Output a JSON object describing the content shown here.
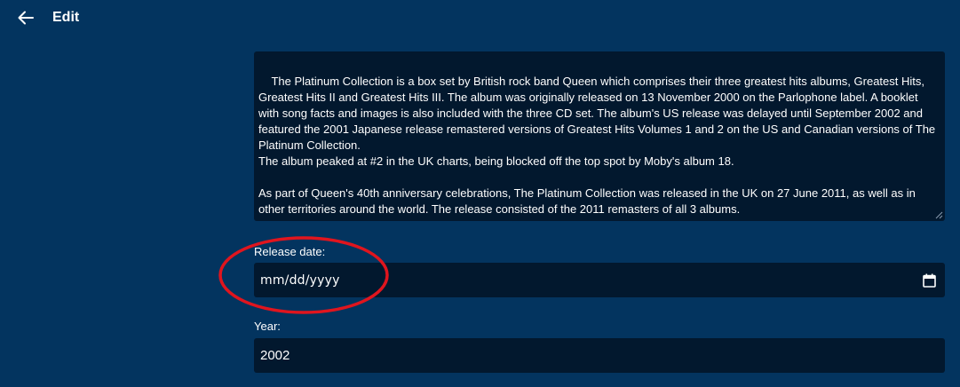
{
  "header": {
    "title": "Edit",
    "back_icon": "arrow-left-icon"
  },
  "description": {
    "value": "The Platinum Collection is a box set by British rock band Queen which comprises their three greatest hits albums, Greatest Hits, Greatest Hits II and Greatest Hits III. The album was originally released on 13 November 2000 on the Parlophone label. A booklet with song facts and images is also included with the three CD set. The album's US release was delayed until September 2002 and featured the 2001 Japanese release remastered versions of Greatest Hits Volumes 1 and 2 on the US and Canadian versions of The Platinum Collection.\nThe album peaked at #2 in the UK charts, being blocked off the top spot by Moby's album 18.\n\nAs part of Queen's 40th anniversary celebrations, The Platinum Collection was released in the UK on 27 June 2011, as well as in other territories around the world. The release consisted of the 2011 remasters of all 3 albums."
  },
  "release_date": {
    "label": "Release date:",
    "placeholder": "mm/dd/yyyy",
    "icon": "calendar-icon"
  },
  "year": {
    "label": "Year:",
    "value": "2002"
  },
  "colors": {
    "background": "#03345f",
    "field_background": "#02182e",
    "annotation": "#e0151e"
  }
}
